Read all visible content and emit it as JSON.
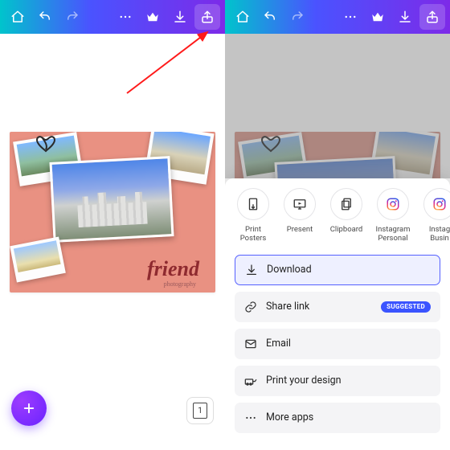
{
  "toolbar": {
    "home": "home-icon",
    "undo": "undo-icon",
    "redo": "redo-icon",
    "more": "more-icon",
    "premium": "crown-icon",
    "download": "download-icon",
    "share": "share-icon"
  },
  "artboard": {
    "title_text": "friend",
    "subtitle_text": "photography"
  },
  "page_indicator": {
    "count": "1"
  },
  "share_targets": [
    {
      "id": "print-posters",
      "label": "Print\nPosters"
    },
    {
      "id": "present",
      "label": "Present"
    },
    {
      "id": "clipboard",
      "label": "Clipboard"
    },
    {
      "id": "instagram-personal",
      "label": "Instagram\nPersonal"
    },
    {
      "id": "instagram-business",
      "label": "Instag\nBusin"
    }
  ],
  "actions": {
    "download": "Download",
    "share_link": "Share link",
    "share_link_badge": "SUGGESTED",
    "email": "Email",
    "print": "Print your design",
    "more": "More apps"
  }
}
